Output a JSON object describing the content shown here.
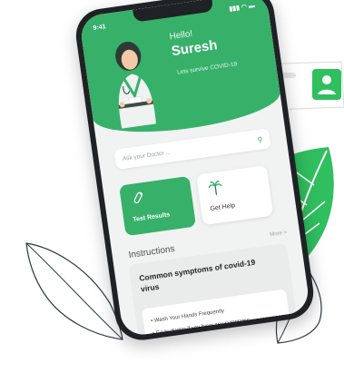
{
  "status_bar": {
    "time": "9:41"
  },
  "header": {
    "greeting": "Hello!",
    "name": "Suresh",
    "tagline": "Lets survive COVID-19"
  },
  "search": {
    "placeholder": "Ask your Doctor...."
  },
  "cards": [
    {
      "label": "Test Results",
      "icon": "test-tube-icon"
    },
    {
      "label": "Get Help",
      "icon": "palm-tree-icon"
    }
  ],
  "instructions": {
    "title": "Instructions",
    "more": "More >",
    "card_title": "Common symptoms of covid-19 virus",
    "bullets": [
      "Wash Your Hands Frequently",
      "Go to doctor if you have any symptoms"
    ]
  },
  "colors": {
    "brand_green": "#37b06a",
    "leaf_green": "#2fbf5f",
    "screen_bg": "#f1f3f2"
  }
}
